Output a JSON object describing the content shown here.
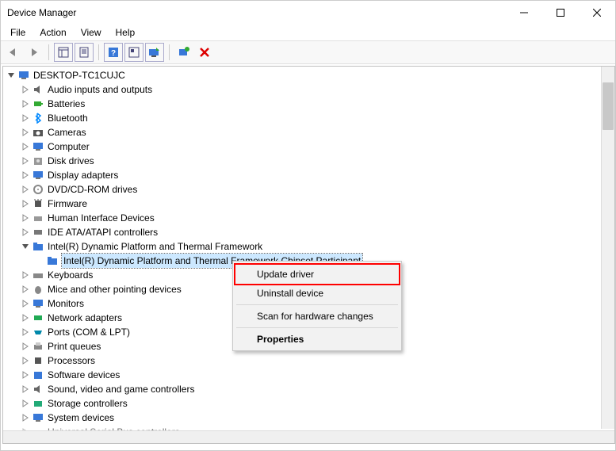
{
  "titlebar": {
    "title": "Device Manager"
  },
  "menubar": {
    "file": "File",
    "action": "Action",
    "view": "View",
    "help": "Help"
  },
  "tree": {
    "root": "DESKTOP-TC1CUJC",
    "nodes": [
      {
        "label": "Audio inputs and outputs"
      },
      {
        "label": "Batteries"
      },
      {
        "label": "Bluetooth"
      },
      {
        "label": "Cameras"
      },
      {
        "label": "Computer"
      },
      {
        "label": "Disk drives"
      },
      {
        "label": "Display adapters"
      },
      {
        "label": "DVD/CD-ROM drives"
      },
      {
        "label": "Firmware"
      },
      {
        "label": "Human Interface Devices"
      },
      {
        "label": "IDE ATA/ATAPI controllers"
      },
      {
        "label": "Intel(R) Dynamic Platform and Thermal Framework",
        "expanded": true,
        "children": [
          {
            "label": "Intel(R) Dynamic Platform and Thermal Framework Chipset Participant",
            "selected": true
          }
        ]
      },
      {
        "label": "Keyboards"
      },
      {
        "label": "Mice and other pointing devices"
      },
      {
        "label": "Monitors"
      },
      {
        "label": "Network adapters"
      },
      {
        "label": "Ports (COM & LPT)"
      },
      {
        "label": "Print queues"
      },
      {
        "label": "Processors"
      },
      {
        "label": "Software devices"
      },
      {
        "label": "Sound, video and game controllers"
      },
      {
        "label": "Storage controllers"
      },
      {
        "label": "System devices"
      },
      {
        "label": "Universal Serial Bus controllers"
      }
    ]
  },
  "contextmenu": {
    "update_driver": "Update driver",
    "uninstall_device": "Uninstall device",
    "scan_for_hardware_changes": "Scan for hardware changes",
    "properties": "Properties"
  }
}
